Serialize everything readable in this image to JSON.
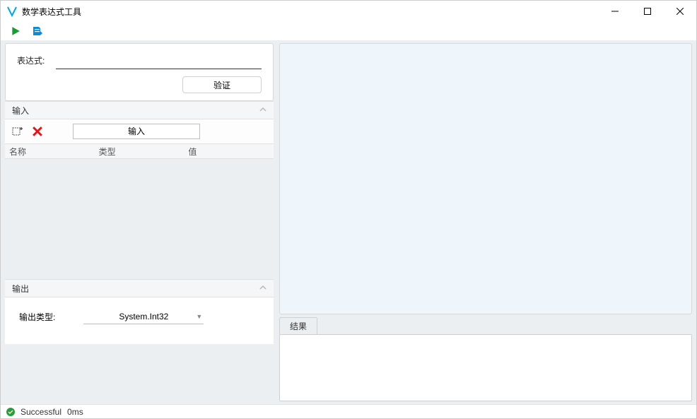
{
  "window": {
    "title": "数学表达式工具"
  },
  "expression": {
    "label": "表达式:",
    "value": "",
    "verify_label": "验证"
  },
  "sections": {
    "input_header": "输入",
    "output_header": "输出"
  },
  "input_area": {
    "dropdown_label": "输入",
    "columns": [
      "名称",
      "类型",
      "值"
    ]
  },
  "output_area": {
    "type_label": "输出类型:",
    "type_value": "System.Int32"
  },
  "result": {
    "tab_label": "结果"
  },
  "status": {
    "text": "Successful",
    "time": "0ms"
  }
}
